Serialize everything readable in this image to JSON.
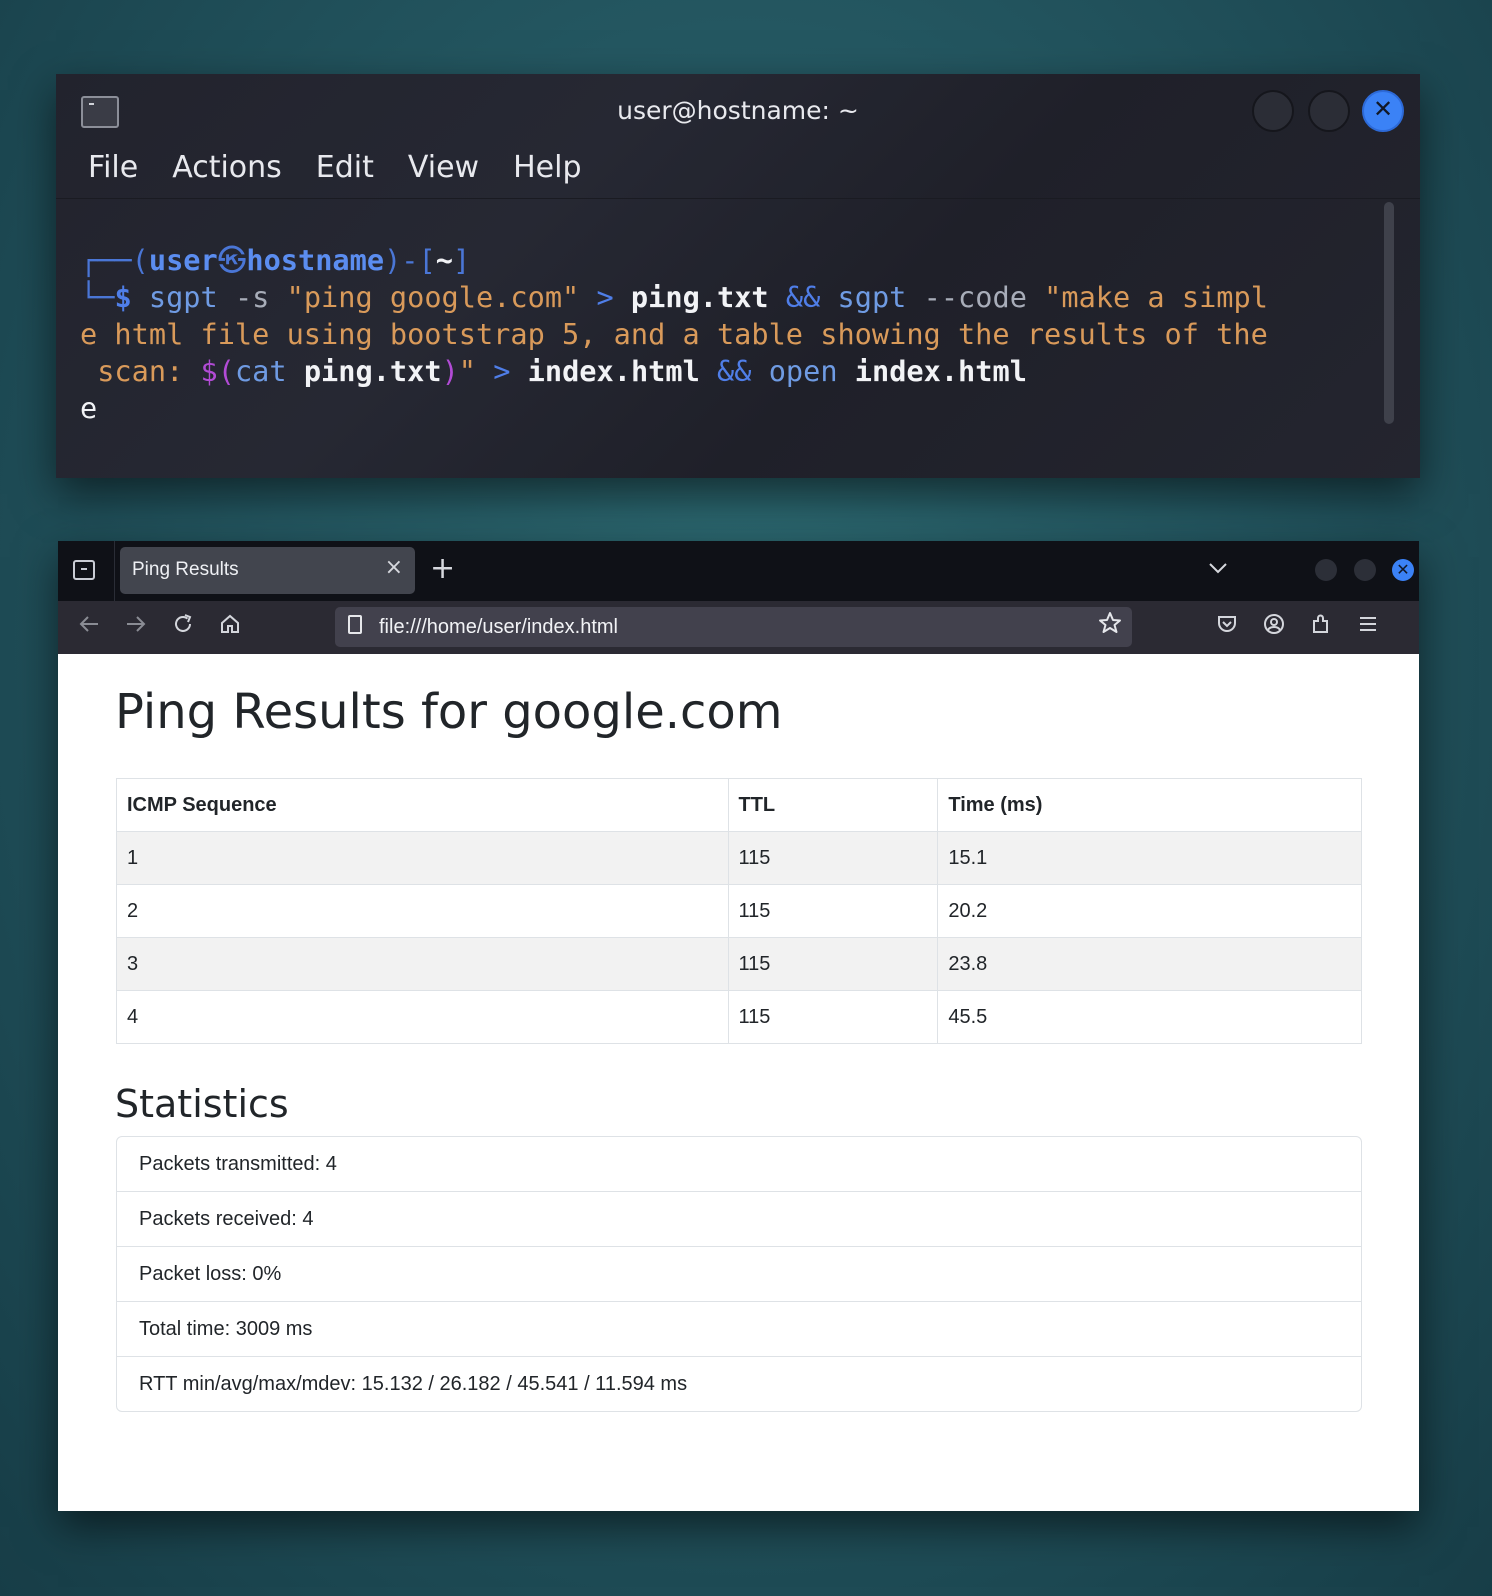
{
  "terminal": {
    "title": "user@hostname: ~",
    "menu": [
      "File",
      "Actions",
      "Edit",
      "View",
      "Help"
    ],
    "prompt": {
      "frame_top": "┌──(",
      "user": "user",
      "at": "㉿",
      "host": "hostname",
      "close_paren": ")-[",
      "dir": "~",
      "close_bracket": "]",
      "frame_bottom": "└─",
      "dollar": "$"
    },
    "command": {
      "l1_sgpt": " sgpt",
      "l1_flag": " -s ",
      "l1_str": "\"ping google.com\"",
      "l1_redirect": " > ",
      "l1_file": "ping.txt",
      "l1_and": " && ",
      "l1_sgpt2": "sgpt",
      "l1_flag2": " --code ",
      "l1_str2": "\"make a simpl",
      "l2_str": "e html file using bootstrap 5, and a table showing the results of the",
      "l3_str": " scan: ",
      "l3_dollar": "$(",
      "l3_cat": "cat ",
      "l3_file": "ping.txt",
      "l3_close": ")",
      "l3_quote": "\"",
      "l3_redirect": " > ",
      "l3_out": "index.html",
      "l3_and": " && ",
      "l3_open": "open ",
      "l3_out2": "index.html",
      "l4": "e"
    }
  },
  "browser": {
    "tab_title": "Ping Results",
    "tab_close": "×",
    "new_tab": "+",
    "url": "file:///home/user/index.html"
  },
  "page": {
    "heading": "Ping Results for google.com",
    "table": {
      "headers": [
        "ICMP Sequence",
        "TTL",
        "Time (ms)"
      ],
      "rows": [
        [
          "1",
          "115",
          "15.1"
        ],
        [
          "2",
          "115",
          "20.2"
        ],
        [
          "3",
          "115",
          "23.8"
        ],
        [
          "4",
          "115",
          "45.5"
        ]
      ]
    },
    "stats_heading": "Statistics",
    "stats": [
      "Packets transmitted: 4",
      "Packets received: 4",
      "Packet loss: 0%",
      "Total time: 3009 ms",
      "RTT min/avg/max/mdev: 15.132 / 26.182 / 45.541 / 11.594 ms"
    ]
  },
  "icons": {
    "terminal": "terminal-app-icon",
    "close": "close-icon",
    "back": "arrow-left-icon",
    "forward": "arrow-right-icon",
    "reload": "reload-icon",
    "home": "home-icon",
    "bookmark": "star-icon",
    "pocket": "pocket-icon",
    "account": "account-icon",
    "extensions": "puzzle-icon",
    "menu": "hamburger-menu-icon"
  }
}
